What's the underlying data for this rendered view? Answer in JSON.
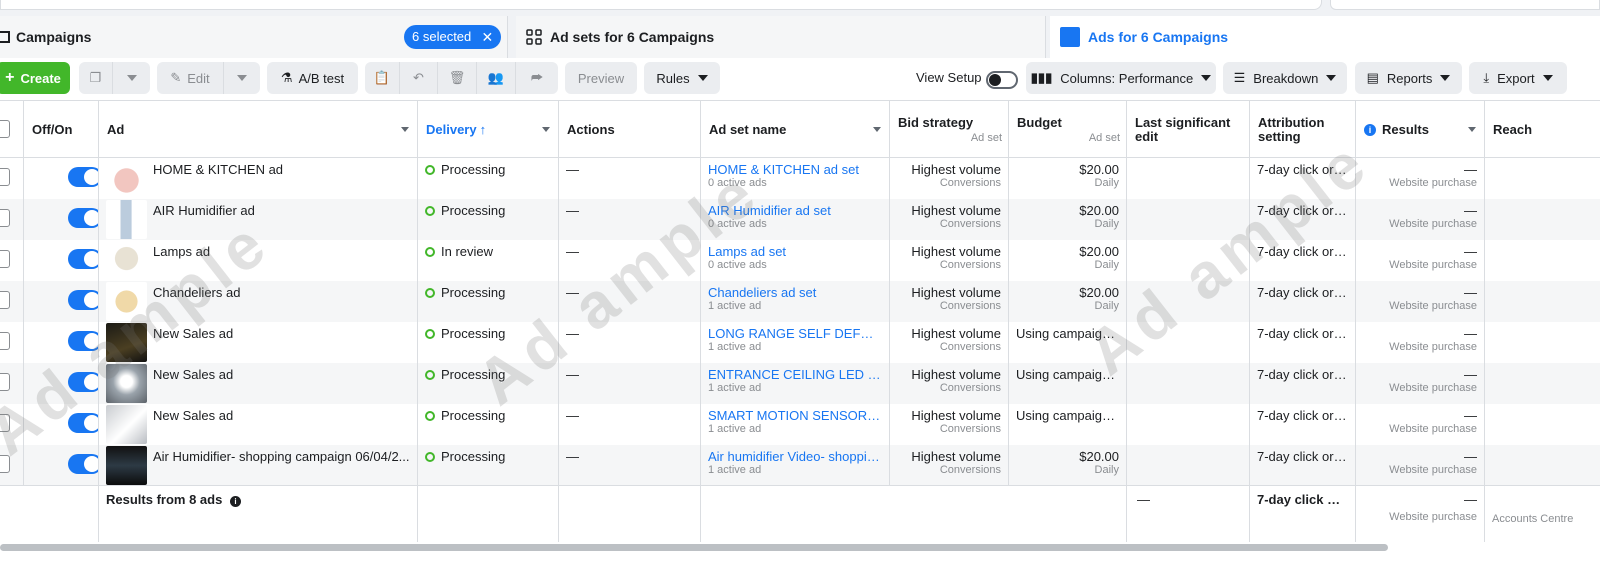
{
  "tabs": {
    "campaigns": "Campaigns",
    "selected_pill": "6 selected",
    "adsets": "Ad sets for 6 Campaigns",
    "ads": "Ads for 6 Campaigns"
  },
  "toolbar": {
    "create": "Create",
    "edit": "Edit",
    "ab_test": "A/B test",
    "preview": "Preview",
    "rules": "Rules",
    "view_setup": "View Setup",
    "columns": "Columns: Performance",
    "breakdown": "Breakdown",
    "reports": "Reports",
    "export": "Export"
  },
  "columns": {
    "off_on": "Off/On",
    "ad": "Ad",
    "delivery": "Delivery",
    "actions": "Actions",
    "adset_name": "Ad set name",
    "bid_strategy": "Bid strategy",
    "bid_sub": "Ad set",
    "budget": "Budget",
    "budget_sub": "Ad set",
    "last_edit": "Last significant edit",
    "attribution": "Attribution setting",
    "results": "Results",
    "reach": "Reach"
  },
  "rows": [
    {
      "ad": "HOME & KITCHEN ad",
      "delivery": "Processing",
      "actions": "—",
      "adset": "HOME & KITCHEN ad set",
      "adset_sub": "0 active ads",
      "bid": "Highest volume",
      "bid_sub": "Conversions",
      "budget": "$20.00",
      "budget_sub": "Daily",
      "attribution": "7-day click or 1...",
      "results": "—",
      "results_sub": "Website purchase"
    },
    {
      "ad": "AIR Humidifier ad",
      "delivery": "Processing",
      "actions": "—",
      "adset": "AIR Humidifier ad set",
      "adset_sub": "0 active ads",
      "bid": "Highest volume",
      "bid_sub": "Conversions",
      "budget": "$20.00",
      "budget_sub": "Daily",
      "attribution": "7-day click or 1...",
      "results": "—",
      "results_sub": "Website purchase"
    },
    {
      "ad": "Lamps ad",
      "delivery": "In review",
      "actions": "—",
      "adset": "Lamps ad set",
      "adset_sub": "0 active ads",
      "bid": "Highest volume",
      "bid_sub": "Conversions",
      "budget": "$20.00",
      "budget_sub": "Daily",
      "attribution": "7-day click or 1...",
      "results": "—",
      "results_sub": "Website purchase"
    },
    {
      "ad": "Chandeliers ad",
      "delivery": "Processing",
      "actions": "—",
      "adset": "Chandeliers ad set",
      "adset_sub": "1 active ad",
      "bid": "Highest volume",
      "bid_sub": "Conversions",
      "budget": "$20.00",
      "budget_sub": "Daily",
      "attribution": "7-day click or 1...",
      "results": "—",
      "results_sub": "Website purchase"
    },
    {
      "ad": "New Sales ad",
      "delivery": "Processing",
      "actions": "—",
      "adset": "LONG RANGE SELF DEFENSE ...",
      "adset_sub": "1 active ad",
      "bid": "Highest volume",
      "bid_sub": "Conversions",
      "budget": "Using campaign ...",
      "budget_sub": "",
      "attribution": "7-day click or 1...",
      "results": "—",
      "results_sub": "Website purchase"
    },
    {
      "ad": "New Sales ad",
      "delivery": "Processing",
      "actions": "—",
      "adset": "ENTRANCE CEILING LED LIG...",
      "adset_sub": "1 active ad",
      "bid": "Highest volume",
      "bid_sub": "Conversions",
      "budget": "Using campaign ...",
      "budget_sub": "",
      "attribution": "7-day click or 1...",
      "results": "—",
      "results_sub": "Website purchase"
    },
    {
      "ad": "New Sales ad",
      "delivery": "Processing",
      "actions": "—",
      "adset": "SMART MOTION SENSOR LED...",
      "adset_sub": "1 active ad",
      "bid": "Highest volume",
      "bid_sub": "Conversions",
      "budget": "Using campaign ...",
      "budget_sub": "",
      "attribution": "7-day click or 1...",
      "results": "—",
      "results_sub": "Website purchase"
    },
    {
      "ad": "Air Humidifier- shopping campaign 06/04/2...",
      "delivery": "Processing",
      "actions": "—",
      "adset": "Air humidifier Video- shopping...",
      "adset_sub": "1 active ad",
      "bid": "Highest volume",
      "bid_sub": "Conversions",
      "budget": "$20.00",
      "budget_sub": "Daily",
      "attribution": "7-day click or 1...",
      "results": "—",
      "results_sub": "Website purchase"
    }
  ],
  "footer": {
    "label": "Results from 8 ads",
    "last_edit": "—",
    "attribution": "7-day click or ...",
    "results": "—",
    "results_sub": "Website purchase",
    "reach_sub": "Accounts Centre"
  },
  "watermark": "Ad ample",
  "colors": {
    "accent": "#1876f2",
    "create": "#42b72a",
    "status": "#42b72a"
  }
}
